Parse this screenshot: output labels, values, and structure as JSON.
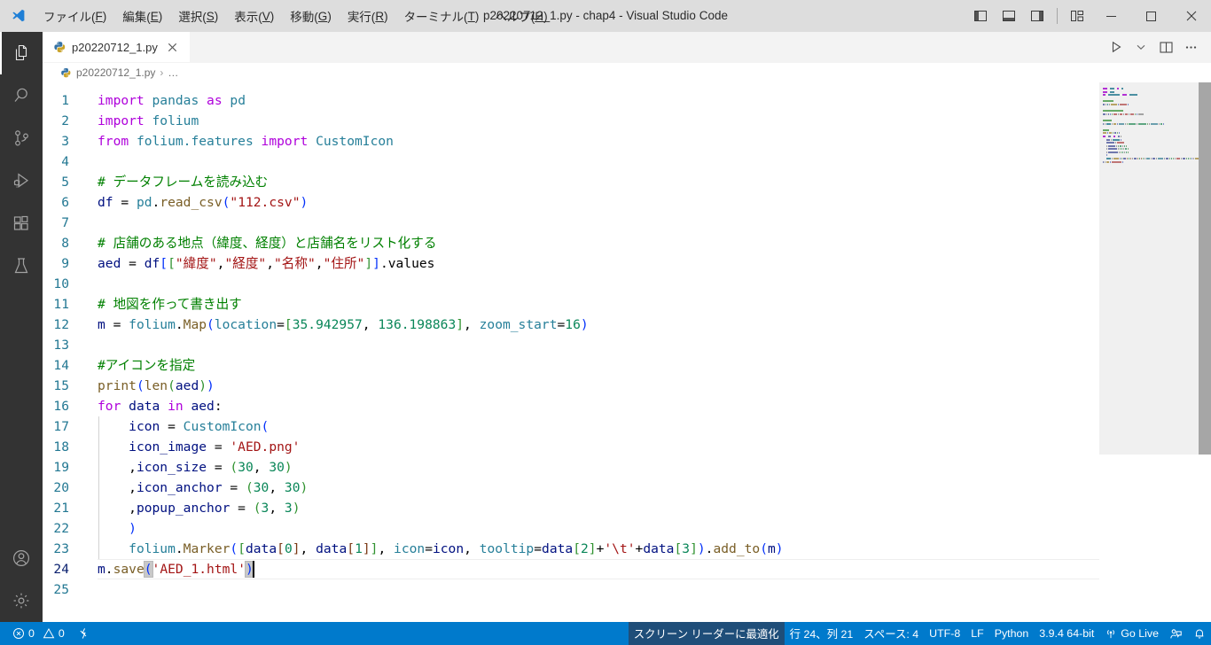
{
  "window": {
    "title": "p20220712_1.py - chap4 - Visual Studio Code",
    "menus": [
      {
        "label": "ファイル(F)",
        "mnemonic": "F"
      },
      {
        "label": "編集(E)",
        "mnemonic": "E"
      },
      {
        "label": "選択(S)",
        "mnemonic": "S"
      },
      {
        "label": "表示(V)",
        "mnemonic": "V"
      },
      {
        "label": "移動(G)",
        "mnemonic": "G"
      },
      {
        "label": "実行(R)",
        "mnemonic": "R"
      },
      {
        "label": "ターミナル(T)",
        "mnemonic": "T"
      },
      {
        "label": "ヘルプ(H)",
        "mnemonic": "H"
      }
    ],
    "layout_buttons": [
      "toggle-primary-sidebar",
      "toggle-panel",
      "toggle-secondary-sidebar",
      "customize-layout"
    ],
    "controls": [
      "minimize",
      "restore",
      "close"
    ]
  },
  "activitybar": {
    "items": [
      {
        "name": "explorer",
        "icon": "files-icon",
        "active": true
      },
      {
        "name": "search",
        "icon": "search-icon",
        "active": false
      },
      {
        "name": "source-control",
        "icon": "source-control-icon",
        "active": false
      },
      {
        "name": "run-and-debug",
        "icon": "run-debug-icon",
        "active": false
      },
      {
        "name": "extensions",
        "icon": "extensions-icon",
        "active": false
      },
      {
        "name": "testing",
        "icon": "beaker-icon",
        "active": false
      }
    ],
    "bottom": [
      {
        "name": "accounts",
        "icon": "account-icon"
      },
      {
        "name": "manage",
        "icon": "gear-icon"
      }
    ]
  },
  "editor": {
    "tab": {
      "label": "p20220712_1.py",
      "icon": "python-icon",
      "close": "×",
      "active": true
    },
    "actions": [
      "run-python-file",
      "run-dropdown-chevron",
      "split-editor-right",
      "more-actions"
    ],
    "breadcrumb": [
      {
        "label": "p20220712_1.py",
        "icon": "python-icon"
      },
      {
        "label": "…",
        "icon": ""
      }
    ],
    "cursor": {
      "line": 24,
      "column": 21
    },
    "lines": [
      {
        "n": 1,
        "indent": 0,
        "tokens": [
          {
            "t": "import",
            "c": "k"
          },
          {
            "t": " ",
            "c": "op"
          },
          {
            "t": "pandas",
            "c": "mod"
          },
          {
            "t": " ",
            "c": "op"
          },
          {
            "t": "as",
            "c": "k"
          },
          {
            "t": " ",
            "c": "op"
          },
          {
            "t": "pd",
            "c": "mod"
          }
        ]
      },
      {
        "n": 2,
        "indent": 0,
        "tokens": [
          {
            "t": "import",
            "c": "k"
          },
          {
            "t": " ",
            "c": "op"
          },
          {
            "t": "folium",
            "c": "mod"
          }
        ]
      },
      {
        "n": 3,
        "indent": 0,
        "tokens": [
          {
            "t": "from",
            "c": "k"
          },
          {
            "t": " ",
            "c": "op"
          },
          {
            "t": "folium.features",
            "c": "mod"
          },
          {
            "t": " ",
            "c": "op"
          },
          {
            "t": "import",
            "c": "k"
          },
          {
            "t": " ",
            "c": "op"
          },
          {
            "t": "CustomIcon",
            "c": "mod"
          }
        ]
      },
      {
        "n": 4,
        "indent": 0,
        "tokens": []
      },
      {
        "n": 5,
        "indent": 0,
        "tokens": [
          {
            "t": "# データフレームを読み込む",
            "c": "cmt"
          }
        ]
      },
      {
        "n": 6,
        "indent": 0,
        "tokens": [
          {
            "t": "df",
            "c": "var"
          },
          {
            "t": " = ",
            "c": "op"
          },
          {
            "t": "pd",
            "c": "mod"
          },
          {
            "t": ".",
            "c": "op"
          },
          {
            "t": "read_csv",
            "c": "fn"
          },
          {
            "t": "(",
            "c": "brk1"
          },
          {
            "t": "\"112.csv\"",
            "c": "str"
          },
          {
            "t": ")",
            "c": "brk1"
          }
        ]
      },
      {
        "n": 7,
        "indent": 0,
        "tokens": []
      },
      {
        "n": 8,
        "indent": 0,
        "tokens": [
          {
            "t": "# 店舗のある地点（緯度、経度）と店舗名をリスト化する",
            "c": "cmt"
          }
        ]
      },
      {
        "n": 9,
        "indent": 0,
        "tokens": [
          {
            "t": "aed",
            "c": "var"
          },
          {
            "t": " = ",
            "c": "op"
          },
          {
            "t": "df",
            "c": "var"
          },
          {
            "t": "[",
            "c": "brk1"
          },
          {
            "t": "[",
            "c": "brk2"
          },
          {
            "t": "\"緯度\"",
            "c": "str"
          },
          {
            "t": ",",
            "c": "op"
          },
          {
            "t": "\"経度\"",
            "c": "str"
          },
          {
            "t": ",",
            "c": "op"
          },
          {
            "t": "\"名称\"",
            "c": "str"
          },
          {
            "t": ",",
            "c": "op"
          },
          {
            "t": "\"住所\"",
            "c": "str"
          },
          {
            "t": "]",
            "c": "brk2"
          },
          {
            "t": "]",
            "c": "brk1"
          },
          {
            "t": ".values",
            "c": "op"
          }
        ]
      },
      {
        "n": 10,
        "indent": 0,
        "tokens": []
      },
      {
        "n": 11,
        "indent": 0,
        "tokens": [
          {
            "t": "# 地図を作って書き出す",
            "c": "cmt"
          }
        ]
      },
      {
        "n": 12,
        "indent": 0,
        "tokens": [
          {
            "t": "m",
            "c": "var"
          },
          {
            "t": " = ",
            "c": "op"
          },
          {
            "t": "folium",
            "c": "mod"
          },
          {
            "t": ".",
            "c": "op"
          },
          {
            "t": "Map",
            "c": "fn"
          },
          {
            "t": "(",
            "c": "brk1"
          },
          {
            "t": "location",
            "c": "par"
          },
          {
            "t": "=",
            "c": "op"
          },
          {
            "t": "[",
            "c": "brk2"
          },
          {
            "t": "35.942957",
            "c": "num"
          },
          {
            "t": ", ",
            "c": "op"
          },
          {
            "t": "136.198863",
            "c": "num"
          },
          {
            "t": "]",
            "c": "brk2"
          },
          {
            "t": ", ",
            "c": "op"
          },
          {
            "t": "zoom_start",
            "c": "par"
          },
          {
            "t": "=",
            "c": "op"
          },
          {
            "t": "16",
            "c": "num"
          },
          {
            "t": ")",
            "c": "brk1"
          }
        ]
      },
      {
        "n": 13,
        "indent": 0,
        "tokens": []
      },
      {
        "n": 14,
        "indent": 0,
        "tokens": [
          {
            "t": "#アイコンを指定",
            "c": "cmt"
          }
        ]
      },
      {
        "n": 15,
        "indent": 0,
        "tokens": [
          {
            "t": "print",
            "c": "fn"
          },
          {
            "t": "(",
            "c": "brk1"
          },
          {
            "t": "len",
            "c": "fn"
          },
          {
            "t": "(",
            "c": "brk2"
          },
          {
            "t": "aed",
            "c": "var"
          },
          {
            "t": ")",
            "c": "brk2"
          },
          {
            "t": ")",
            "c": "brk1"
          }
        ]
      },
      {
        "n": 16,
        "indent": 0,
        "tokens": [
          {
            "t": "for",
            "c": "k"
          },
          {
            "t": " ",
            "c": "op"
          },
          {
            "t": "data",
            "c": "var"
          },
          {
            "t": " ",
            "c": "op"
          },
          {
            "t": "in",
            "c": "k"
          },
          {
            "t": " ",
            "c": "op"
          },
          {
            "t": "aed",
            "c": "var"
          },
          {
            "t": ":",
            "c": "op"
          }
        ]
      },
      {
        "n": 17,
        "indent": 1,
        "tokens": [
          {
            "t": "    ",
            "c": "op"
          },
          {
            "t": "icon",
            "c": "var"
          },
          {
            "t": " = ",
            "c": "op"
          },
          {
            "t": "CustomIcon",
            "c": "mod"
          },
          {
            "t": "(",
            "c": "brk1"
          }
        ]
      },
      {
        "n": 18,
        "indent": 1,
        "tokens": [
          {
            "t": "    ",
            "c": "op"
          },
          {
            "t": "icon_image",
            "c": "var"
          },
          {
            "t": " = ",
            "c": "op"
          },
          {
            "t": "'AED.png'",
            "c": "str"
          }
        ]
      },
      {
        "n": 19,
        "indent": 1,
        "tokens": [
          {
            "t": "    ",
            "c": "op"
          },
          {
            "t": ",",
            "c": "op"
          },
          {
            "t": "icon_size",
            "c": "var"
          },
          {
            "t": " = ",
            "c": "op"
          },
          {
            "t": "(",
            "c": "brk2"
          },
          {
            "t": "30",
            "c": "num"
          },
          {
            "t": ", ",
            "c": "op"
          },
          {
            "t": "30",
            "c": "num"
          },
          {
            "t": ")",
            "c": "brk2"
          }
        ]
      },
      {
        "n": 20,
        "indent": 1,
        "tokens": [
          {
            "t": "    ",
            "c": "op"
          },
          {
            "t": ",",
            "c": "op"
          },
          {
            "t": "icon_anchor",
            "c": "var"
          },
          {
            "t": " = ",
            "c": "op"
          },
          {
            "t": "(",
            "c": "brk2"
          },
          {
            "t": "30",
            "c": "num"
          },
          {
            "t": ", ",
            "c": "op"
          },
          {
            "t": "30",
            "c": "num"
          },
          {
            "t": ")",
            "c": "brk2"
          }
        ]
      },
      {
        "n": 21,
        "indent": 1,
        "tokens": [
          {
            "t": "    ",
            "c": "op"
          },
          {
            "t": ",",
            "c": "op"
          },
          {
            "t": "popup_anchor",
            "c": "var"
          },
          {
            "t": " = ",
            "c": "op"
          },
          {
            "t": "(",
            "c": "brk2"
          },
          {
            "t": "3",
            "c": "num"
          },
          {
            "t": ", ",
            "c": "op"
          },
          {
            "t": "3",
            "c": "num"
          },
          {
            "t": ")",
            "c": "brk2"
          }
        ]
      },
      {
        "n": 22,
        "indent": 1,
        "tokens": [
          {
            "t": "    ",
            "c": "op"
          },
          {
            "t": ")",
            "c": "brk1"
          }
        ]
      },
      {
        "n": 23,
        "indent": 1,
        "tokens": [
          {
            "t": "    ",
            "c": "op"
          },
          {
            "t": "folium",
            "c": "mod"
          },
          {
            "t": ".",
            "c": "op"
          },
          {
            "t": "Marker",
            "c": "fn"
          },
          {
            "t": "(",
            "c": "brk1"
          },
          {
            "t": "[",
            "c": "brk2"
          },
          {
            "t": "data",
            "c": "var"
          },
          {
            "t": "[",
            "c": "brk3"
          },
          {
            "t": "0",
            "c": "num"
          },
          {
            "t": "]",
            "c": "brk3"
          },
          {
            "t": ", ",
            "c": "op"
          },
          {
            "t": "data",
            "c": "var"
          },
          {
            "t": "[",
            "c": "brk3"
          },
          {
            "t": "1",
            "c": "num"
          },
          {
            "t": "]",
            "c": "brk3"
          },
          {
            "t": "]",
            "c": "brk2"
          },
          {
            "t": ", ",
            "c": "op"
          },
          {
            "t": "icon",
            "c": "par"
          },
          {
            "t": "=",
            "c": "op"
          },
          {
            "t": "icon",
            "c": "var"
          },
          {
            "t": ", ",
            "c": "op"
          },
          {
            "t": "tooltip",
            "c": "par"
          },
          {
            "t": "=",
            "c": "op"
          },
          {
            "t": "data",
            "c": "var"
          },
          {
            "t": "[",
            "c": "brk2"
          },
          {
            "t": "2",
            "c": "num"
          },
          {
            "t": "]",
            "c": "brk2"
          },
          {
            "t": "+",
            "c": "op"
          },
          {
            "t": "'\\t'",
            "c": "str"
          },
          {
            "t": "+",
            "c": "op"
          },
          {
            "t": "data",
            "c": "var"
          },
          {
            "t": "[",
            "c": "brk2"
          },
          {
            "t": "3",
            "c": "num"
          },
          {
            "t": "]",
            "c": "brk2"
          },
          {
            "t": ")",
            "c": "brk1"
          },
          {
            "t": ".",
            "c": "op"
          },
          {
            "t": "add_to",
            "c": "fn"
          },
          {
            "t": "(",
            "c": "brk1"
          },
          {
            "t": "m",
            "c": "var"
          },
          {
            "t": ")",
            "c": "brk1"
          }
        ]
      },
      {
        "n": 24,
        "indent": 0,
        "current": true,
        "tokens": [
          {
            "t": "m",
            "c": "var"
          },
          {
            "t": ".",
            "c": "op"
          },
          {
            "t": "save",
            "c": "fn"
          },
          {
            "t": "(",
            "c": "brk1",
            "hl": true
          },
          {
            "t": "'AED_1.html'",
            "c": "str"
          },
          {
            "t": ")",
            "c": "brk1",
            "hl": true
          },
          {
            "t": "",
            "c": "cursor"
          }
        ]
      },
      {
        "n": 25,
        "indent": 0,
        "tokens": []
      }
    ]
  },
  "statusbar": {
    "errors_icon": "error-circle-icon",
    "errors": "0",
    "warnings_icon": "warning-triangle-icon",
    "warnings": "0",
    "ports_icon": "radio-tower-icon",
    "screen_reader": "スクリーン リーダーに最適化",
    "cursor_position": "行 24、列 21",
    "indentation": "スペース: 4",
    "encoding": "UTF-8",
    "eol": "LF",
    "language": "Python",
    "interpreter": "3.9.4 64-bit",
    "golive_icon": "broadcast-icon",
    "golive": "Go Live",
    "remote_icon": "feedback-icon",
    "bell_icon": "bell-icon"
  },
  "colors": {
    "accent": "#007acc",
    "titlebar_bg": "#dddddd",
    "activitybar_bg": "#333333",
    "editor_bg": "#ffffff",
    "line_number": "#237893",
    "keyword": "#af00db",
    "module": "#267f99",
    "function": "#795e26",
    "variable": "#001080",
    "number": "#098658",
    "string": "#a31515",
    "comment": "#008000",
    "parameter": "#267f99"
  }
}
